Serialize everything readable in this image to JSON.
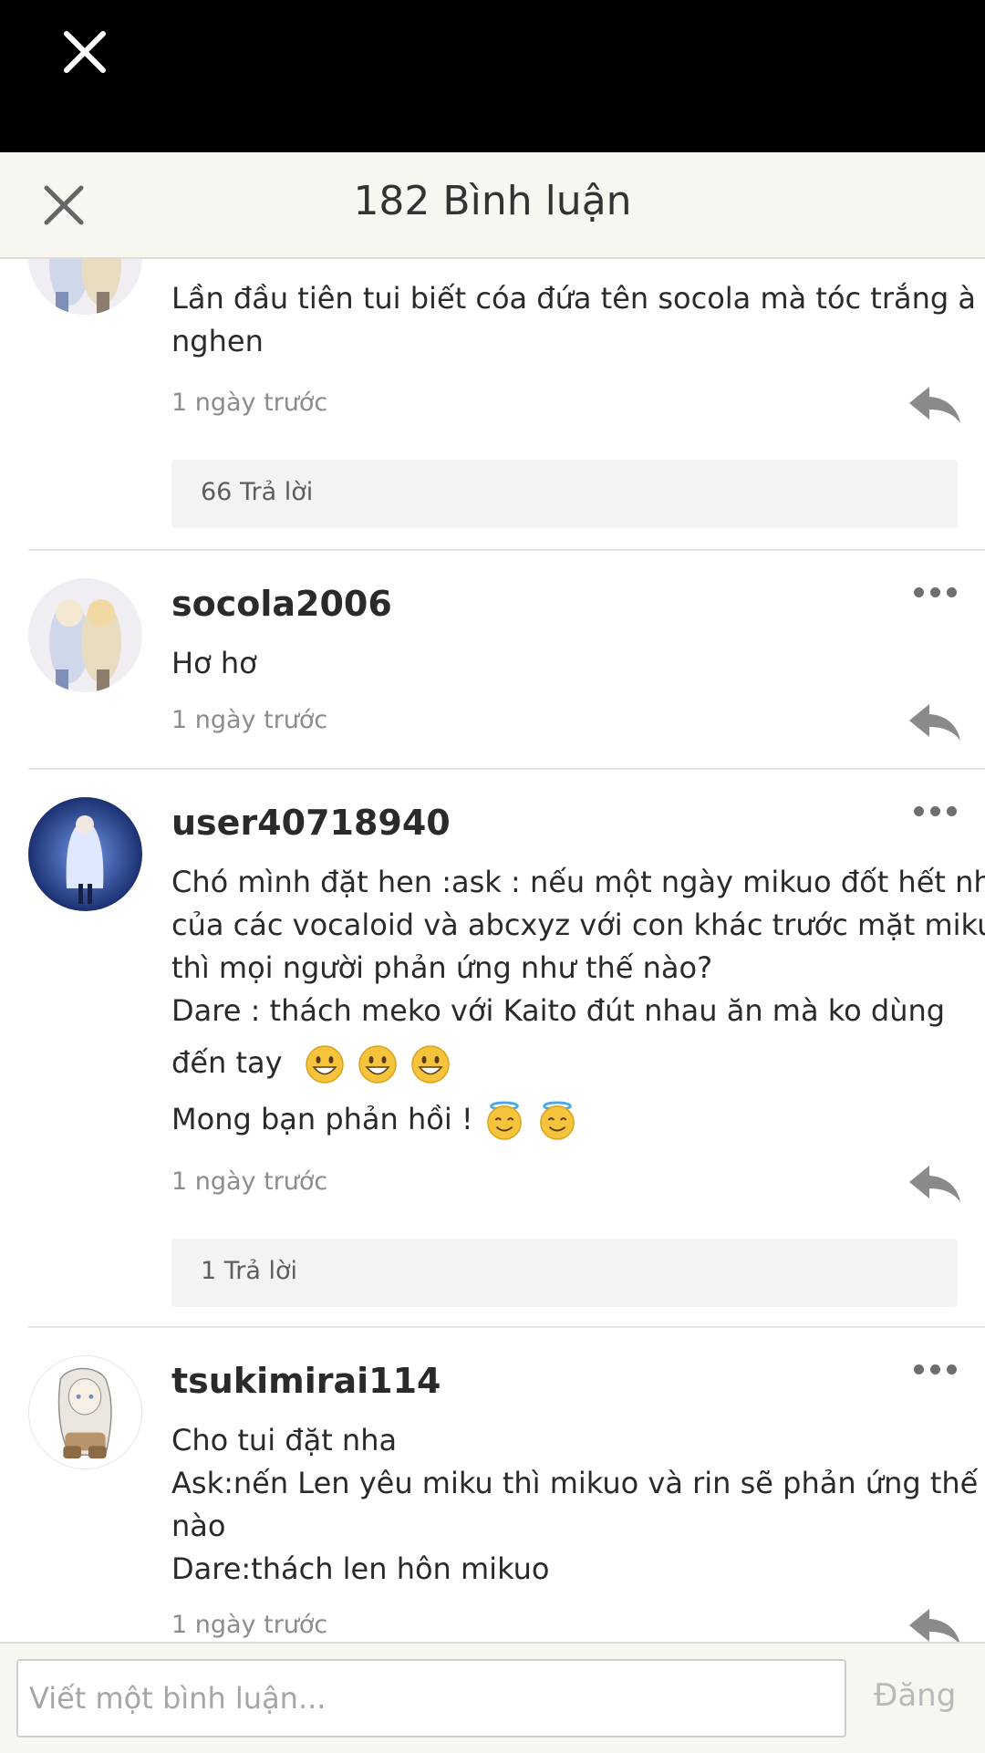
{
  "header": {
    "title": "182 Bình luận"
  },
  "comments": [
    {
      "username": "",
      "lines": [
        "Lần đầu tiên tui biết cóa đứa tên socola mà tóc trắng à",
        "nghen"
      ],
      "time": "1 ngày trước",
      "replies": "66 Trả lời"
    },
    {
      "username": "socola2006",
      "lines": [
        "Hơ hơ"
      ],
      "time": "1 ngày trước"
    },
    {
      "username": "user40718940",
      "lines": [
        "Chó mình đặt hen :ask : nếu một ngày mikuo đốt hết nhà",
        "của các vocaloid và abcxyz với con khác trước mặt miku",
        "thì mọi người phản ứng như thế nào?",
        "Dare : thách meko với Kaito đút nhau ăn mà ko dùng",
        "đến tay",
        "Mong bạn phản hồi !"
      ],
      "emoji": [
        "grinning-face",
        "grinning-face",
        "grinning-face",
        "smiling-face-with-halo",
        "smiling-face-with-halo"
      ],
      "time": "1 ngày trước",
      "replies": "1 Trả lời"
    },
    {
      "username": "tsukimirai114",
      "lines": [
        "Cho tui đặt nha",
        "Ask:nến Len yêu miku thì mikuo và rin sẽ phản ứng thế",
        "nào",
        "Dare:thách len hôn mikuo"
      ],
      "time": "1 ngày trước"
    }
  ],
  "composer": {
    "placeholder": "Viết một bình luận...",
    "post_label": "Đăng"
  },
  "icons": {
    "close": "close-icon",
    "more": "more-dots-icon",
    "reply": "reply-arrow-icon"
  },
  "colors": {
    "topbar": "#000000",
    "header_bg": "#f7f6f1",
    "reply_icon": "#8a8a8a",
    "muted_text": "#8c8c8c"
  }
}
